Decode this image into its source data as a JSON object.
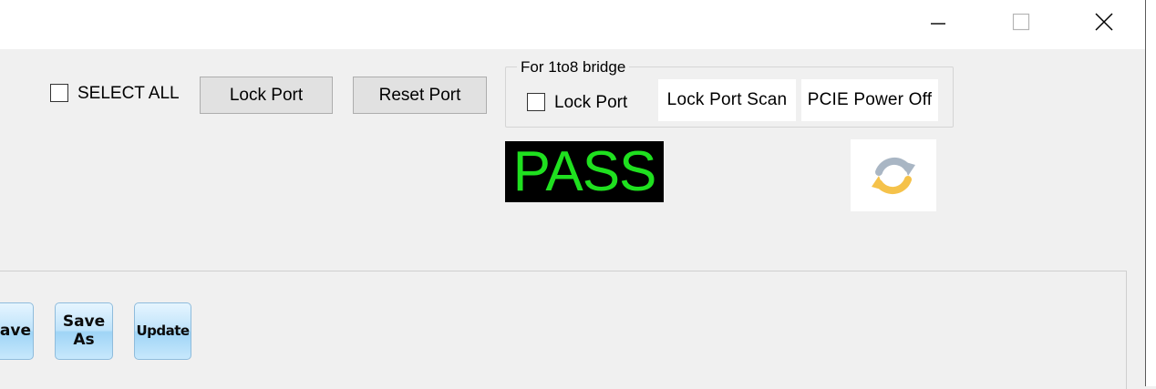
{
  "window": {
    "minimize_icon": "minimize-icon",
    "maximize_icon": "maximize-icon",
    "close_icon": "close-icon"
  },
  "toolbar": {
    "select_all_label": "SELECT ALL",
    "select_all_checked": false,
    "lock_port_label": "Lock Port",
    "reset_port_label": "Reset Port"
  },
  "bridge_group": {
    "title": "For 1to8 bridge",
    "lock_port_label": "Lock Port",
    "lock_port_checked": false,
    "lock_port_scan_label": "Lock Port Scan",
    "pcie_power_off_label": "PCIE Power Off"
  },
  "status": {
    "text": "PASS",
    "color": "#1fe01f"
  },
  "refresh_icon": "refresh-icon",
  "actions": {
    "save_label": "ave",
    "save_as_line1": "Save",
    "save_as_line2": "As",
    "update_label": "Update"
  }
}
